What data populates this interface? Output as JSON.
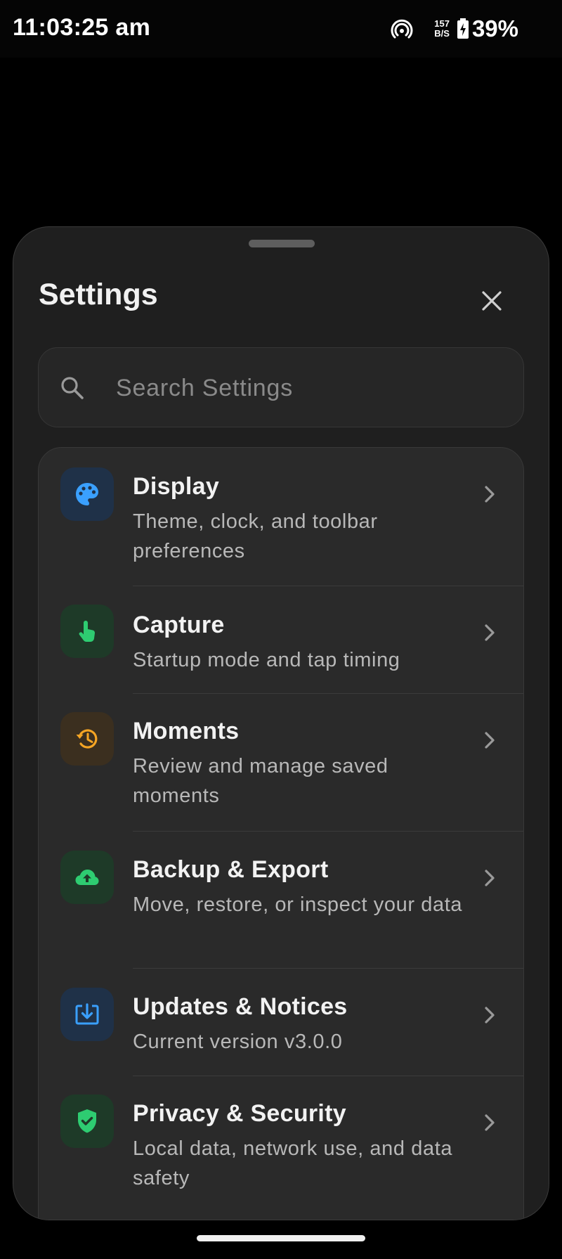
{
  "status_bar": {
    "time": "11:03:25 am",
    "net_speed_value": "157",
    "net_speed_unit": "B/S",
    "battery": "39%"
  },
  "sheet": {
    "title": "Settings",
    "search": {
      "placeholder": "Search Settings",
      "value": ""
    }
  },
  "items": [
    {
      "title": "Display",
      "subtitle": "Theme, clock, and toolbar preferences",
      "icon": "palette-icon",
      "icon_color": "#3aa0ff",
      "tile_color": "#1f3148"
    },
    {
      "title": "Capture",
      "subtitle": "Startup mode and tap timing",
      "icon": "touch-icon",
      "icon_color": "#2ecc71",
      "tile_color": "#1e3a28"
    },
    {
      "title": "Moments",
      "subtitle": "Review and manage saved moments",
      "icon": "history-icon",
      "icon_color": "#f5a524",
      "tile_color": "#3b2f1f"
    },
    {
      "title": "Backup & Export",
      "subtitle": "Move, restore, or inspect your data",
      "icon": "cloud-upload-icon",
      "icon_color": "#2ecc71",
      "tile_color": "#1e3a28"
    },
    {
      "title": "Updates & Notices",
      "subtitle": "Current version v3.0.0",
      "icon": "system-update-icon",
      "icon_color": "#3aa0ff",
      "tile_color": "#1f3148"
    },
    {
      "title": "Privacy & Security",
      "subtitle": "Local data, network use, and data safety",
      "icon": "shield-check-icon",
      "icon_color": "#2ecc71",
      "tile_color": "#1e3a28"
    }
  ]
}
